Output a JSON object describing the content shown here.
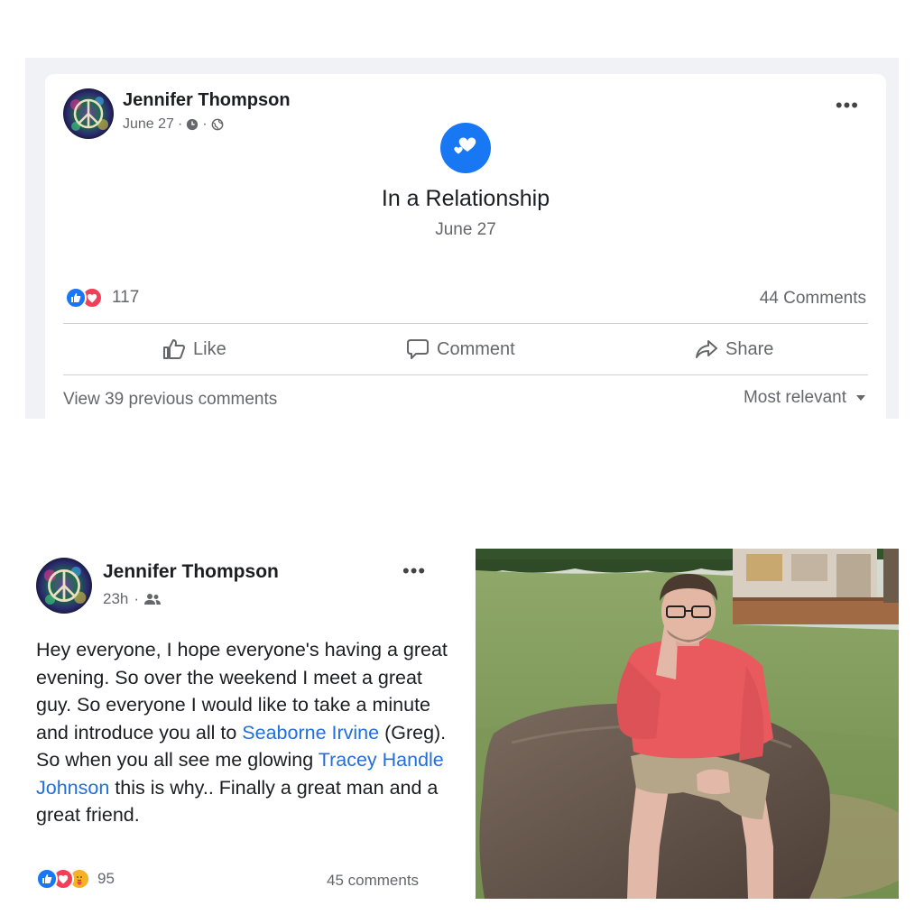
{
  "top_post": {
    "author": "Jennifer Thompson",
    "date": "June 27",
    "relationship_status": "In a Relationship",
    "relationship_date": "June 27",
    "reaction_count": "117",
    "comments_count": "44 Comments",
    "actions": {
      "like": "Like",
      "comment": "Comment",
      "share": "Share"
    },
    "view_previous": "View 39 previous comments",
    "sort_label": "Most relevant"
  },
  "bottom_post": {
    "author": "Jennifer Thompson",
    "time": "23h",
    "text_part_1": "Hey everyone, I hope everyone's having a great evening. So over the weekend I meet a great guy. So everyone I would like to take a minute  and introduce you all to ",
    "mention_1": "Seaborne Irvine",
    "text_part_2": " (Greg).  So when you all see me glowing ",
    "mention_2": "Tracey Handle Johnson",
    "text_part_3": "  this is why.. Finally a great man and a great friend.",
    "reaction_count": "95",
    "comments_count": "45 comments"
  },
  "colors": {
    "facebook_blue": "#1877f2",
    "love_red": "#f33e58",
    "care_yellow": "#f7b125",
    "mention_blue": "#216fdb",
    "secondary_text": "#65676b"
  },
  "icons": {
    "avatar": "psychedelic-peace-sign-avatar",
    "relationship": "hearts-icon",
    "like": "thumbs-up-icon",
    "comment": "speech-bubble-icon",
    "share": "share-arrow-icon",
    "sort": "caret-down-icon",
    "clock": "clock-icon",
    "globe": "globe-icon",
    "friends": "friends-icon",
    "more": "more-options-icon"
  }
}
